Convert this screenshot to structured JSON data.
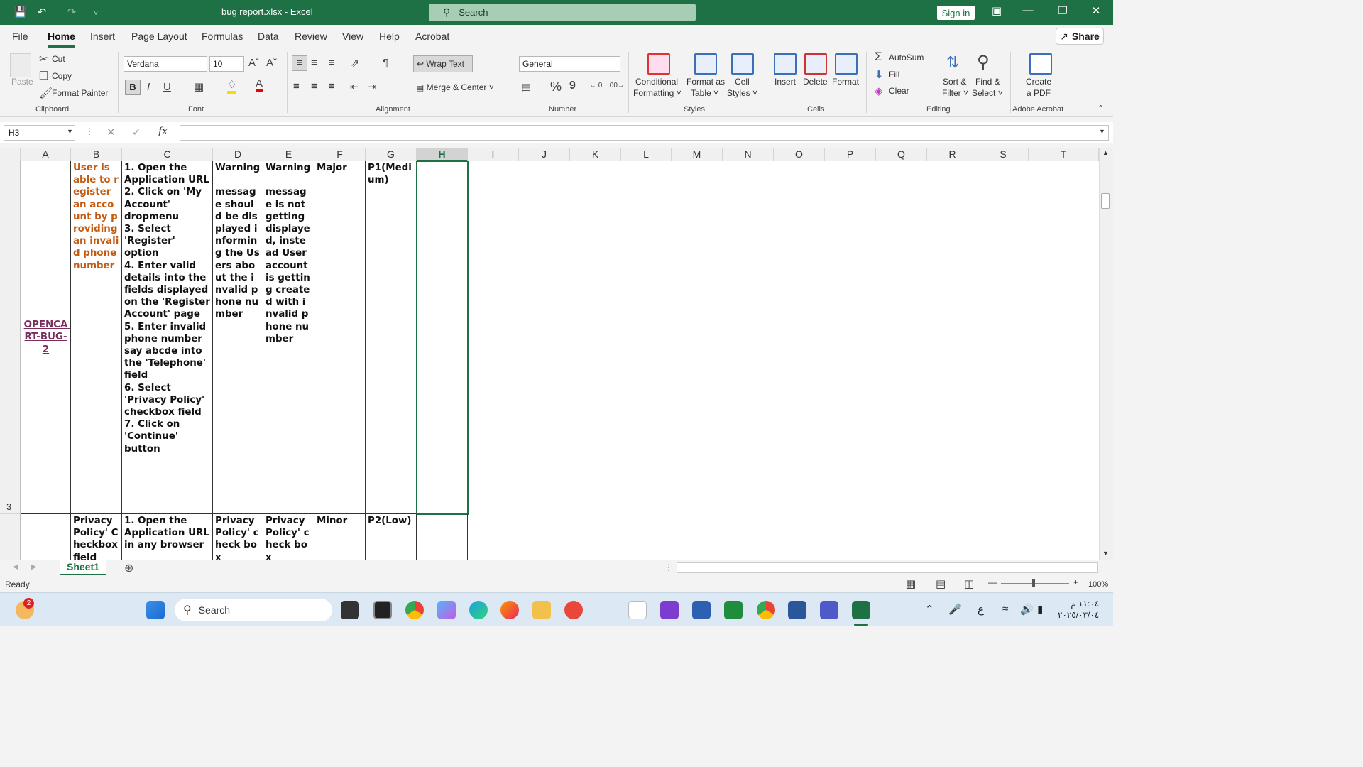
{
  "titlebar": {
    "title": "bug report.xlsx  -  Excel",
    "search_placeholder": "Search",
    "sign_in": "Sign in"
  },
  "menu": {
    "tabs": [
      "File",
      "Home",
      "Insert",
      "Page Layout",
      "Formulas",
      "Data",
      "Review",
      "View",
      "Help",
      "Acrobat"
    ],
    "active": "Home",
    "share": "Share"
  },
  "ribbon": {
    "clipboard": {
      "paste": "Paste",
      "cut": "Cut",
      "copy": "Copy",
      "format_painter": "Format Painter",
      "label": "Clipboard"
    },
    "font": {
      "name": "Verdana",
      "size": "10",
      "bold": "B",
      "italic": "I",
      "underline": "U",
      "label": "Font"
    },
    "alignment": {
      "wrap_text": "Wrap Text",
      "merge_center": "Merge & Center",
      "label": "Alignment"
    },
    "number": {
      "format": "General",
      "percent": "%",
      "comma": "9",
      "label": "Number"
    },
    "styles": {
      "conditional": "Conditional",
      "formatting": "Formatting",
      "format_as": "Format as",
      "table": "Table",
      "cell": "Cell",
      "styles_txt": "Styles",
      "label": "Styles"
    },
    "cells": {
      "insert": "Insert",
      "delete": "Delete",
      "format": "Format",
      "label": "Cells"
    },
    "editing": {
      "autosum": "AutoSum",
      "fill": "Fill",
      "clear": "Clear",
      "sort": "Sort &",
      "filter": "Filter",
      "find": "Find &",
      "select": "Select",
      "label": "Editing"
    },
    "acrobat": {
      "create": "Create",
      "pdf": "a PDF",
      "label": "Adobe Acrobat"
    }
  },
  "formula_bar": {
    "name_box": "H3",
    "fx": "fx",
    "value": ""
  },
  "grid": {
    "columns": [
      "A",
      "B",
      "C",
      "D",
      "E",
      "F",
      "G",
      "H",
      "I",
      "J",
      "K",
      "L",
      "M",
      "N",
      "O",
      "P",
      "Q",
      "R",
      "S",
      "T"
    ],
    "selected_column": "H",
    "row3": {
      "number": "3",
      "a": "OPENCA RT-BUG-2",
      "b": "User is able to register an account by providing an invalid phone number",
      "c": "1. Open the Application URL\n2. Click on 'My Account' dropmenu\n3. Select 'Register' option\n4. Enter valid details into the fields displayed on the 'Register Account' page\n5. Enter invalid phone number say abcde into the 'Telephone' field\n6. Select 'Privacy Policy' checkbox field\n7. Click on 'Continue' button",
      "d": "Warning\n\nmessage should be displayed informing the Users about the invalid phone number",
      "e": "Warning\n\nmessage is not getting displayed, instead User account is getting created with invalid phone number",
      "f": "Major",
      "g": "P1(Medium)"
    },
    "row4": {
      "b": "Privacy Policy' Checkbox field",
      "c": "1. Open the Application URL in any browser",
      "d": "Privacy Policy' check box",
      "e": "Privacy Policy' check box",
      "f": "Minor",
      "g": "P2(Low)"
    }
  },
  "sheets": {
    "active": "Sheet1"
  },
  "status": {
    "ready": "Ready",
    "zoom": "100%"
  },
  "taskbar": {
    "search": "Search",
    "notification_badge": "2",
    "time": "١١:٠٤ م",
    "date": "٢٠٢٥/٠٣/٠٤",
    "lang": "ع"
  },
  "colors": {
    "excel_green": "#1e7145",
    "orange_text": "#c55a11",
    "link_purple": "#7b2d5e"
  }
}
